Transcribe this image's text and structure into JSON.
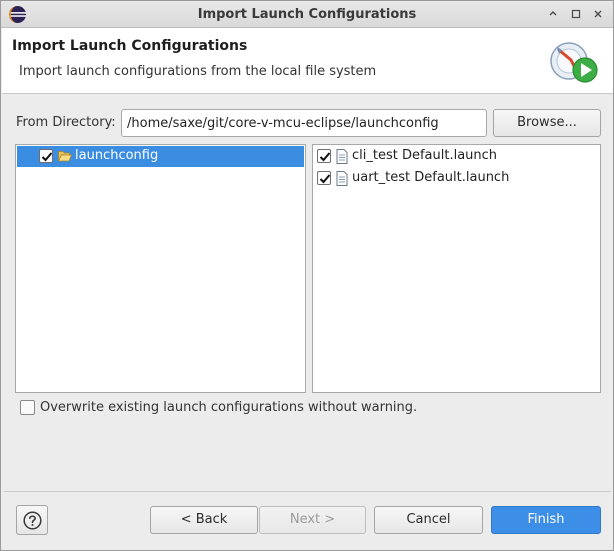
{
  "window": {
    "title": "Import Launch Configurations",
    "controls": {
      "minimize": "⌃",
      "restore": "□",
      "close": "✕"
    }
  },
  "banner": {
    "title": "Import Launch Configurations",
    "description": "Import launch configurations from the local file system",
    "icon": "launch-import-icon"
  },
  "directory": {
    "label": "From Directory:",
    "value": "/home/saxe/git/core-v-mcu-eclipse/launchconfig",
    "browse_label": "Browse..."
  },
  "tree": {
    "items": [
      {
        "label": "launchconfig",
        "checked": true,
        "icon": "folder-open-icon",
        "selected": true
      }
    ]
  },
  "files": {
    "items": [
      {
        "label": "cli_test Default.launch",
        "checked": true,
        "icon": "file-icon"
      },
      {
        "label": "uart_test Default.launch",
        "checked": true,
        "icon": "file-icon"
      }
    ]
  },
  "options": {
    "overwrite_label": "Overwrite existing launch configurations without warning.",
    "overwrite_checked": false
  },
  "buttons": {
    "back": "< Back",
    "next": "Next >",
    "cancel": "Cancel",
    "finish": "Finish",
    "help_icon": "help-icon"
  },
  "colors": {
    "selection": "#3b8de2",
    "primary_button": "#3d8ee6"
  }
}
